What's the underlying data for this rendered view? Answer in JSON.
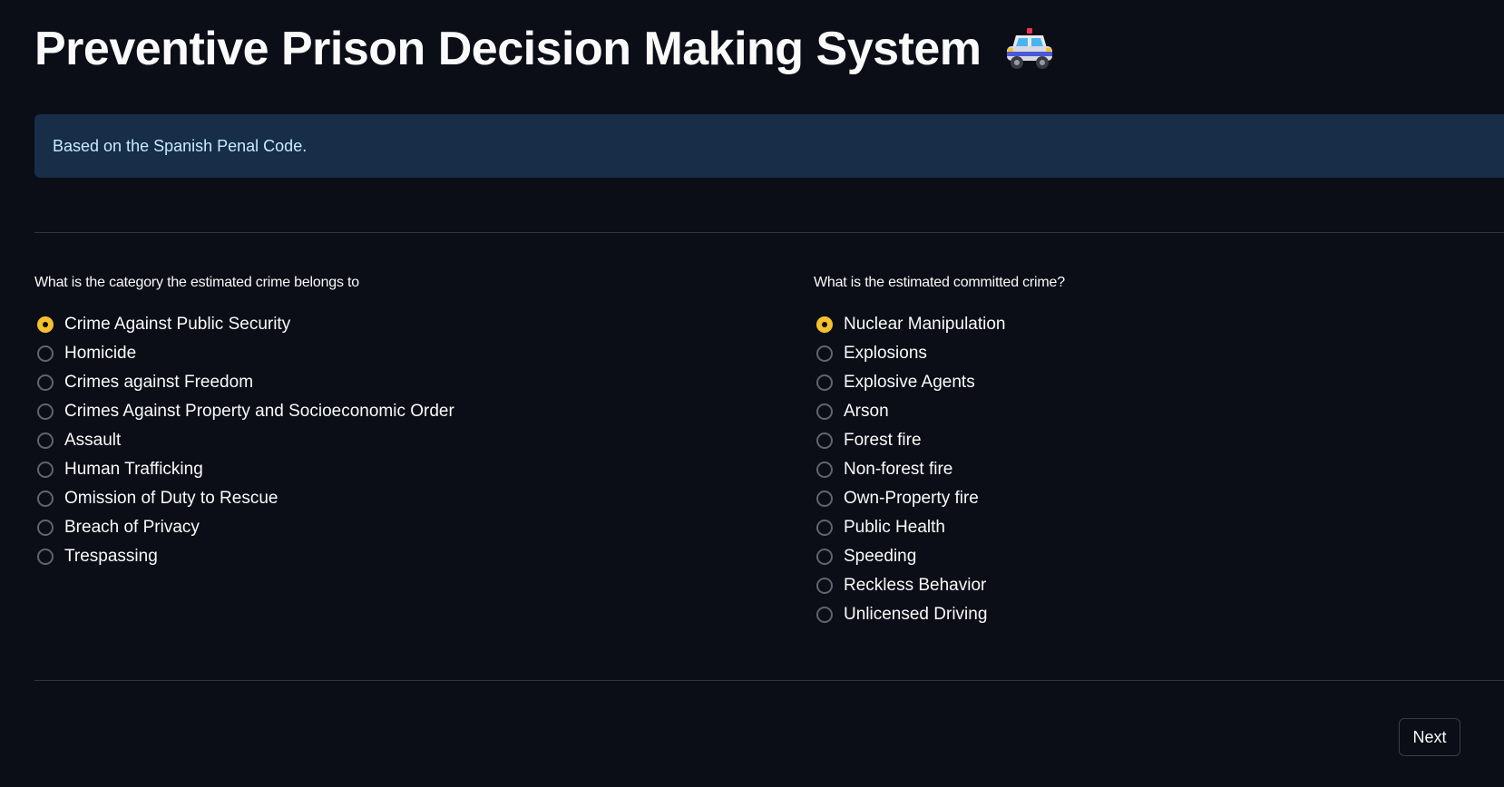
{
  "header": {
    "title": "Preventive Prison Decision Making System",
    "icon": "police-car-icon"
  },
  "info": {
    "text": "Based on the Spanish Penal Code."
  },
  "category": {
    "question": "What is the category the estimated crime belongs to",
    "selected": "Crime Against Public Security",
    "options": [
      "Crime Against Public Security",
      "Homicide",
      "Crimes against Freedom",
      "Crimes Against Property and Socioeconomic Order",
      "Assault",
      "Human Trafficking",
      "Omission of Duty to Rescue",
      "Breach of Privacy",
      "Trespassing"
    ]
  },
  "crime": {
    "question": "What is the estimated committed crime?",
    "selected": "Nuclear Manipulation",
    "options": [
      "Nuclear Manipulation",
      "Explosions",
      "Explosive Agents",
      "Arson",
      "Forest fire",
      "Non-forest fire",
      "Own-Property fire",
      "Public Health",
      "Speeding",
      "Reckless Behavior",
      "Unlicensed Driving"
    ]
  },
  "footer": {
    "next_label": "Next"
  },
  "colors": {
    "background": "#0b0e17",
    "accent": "#f7c12b",
    "info_bg": "#172d48",
    "info_text": "#c7ebff"
  }
}
